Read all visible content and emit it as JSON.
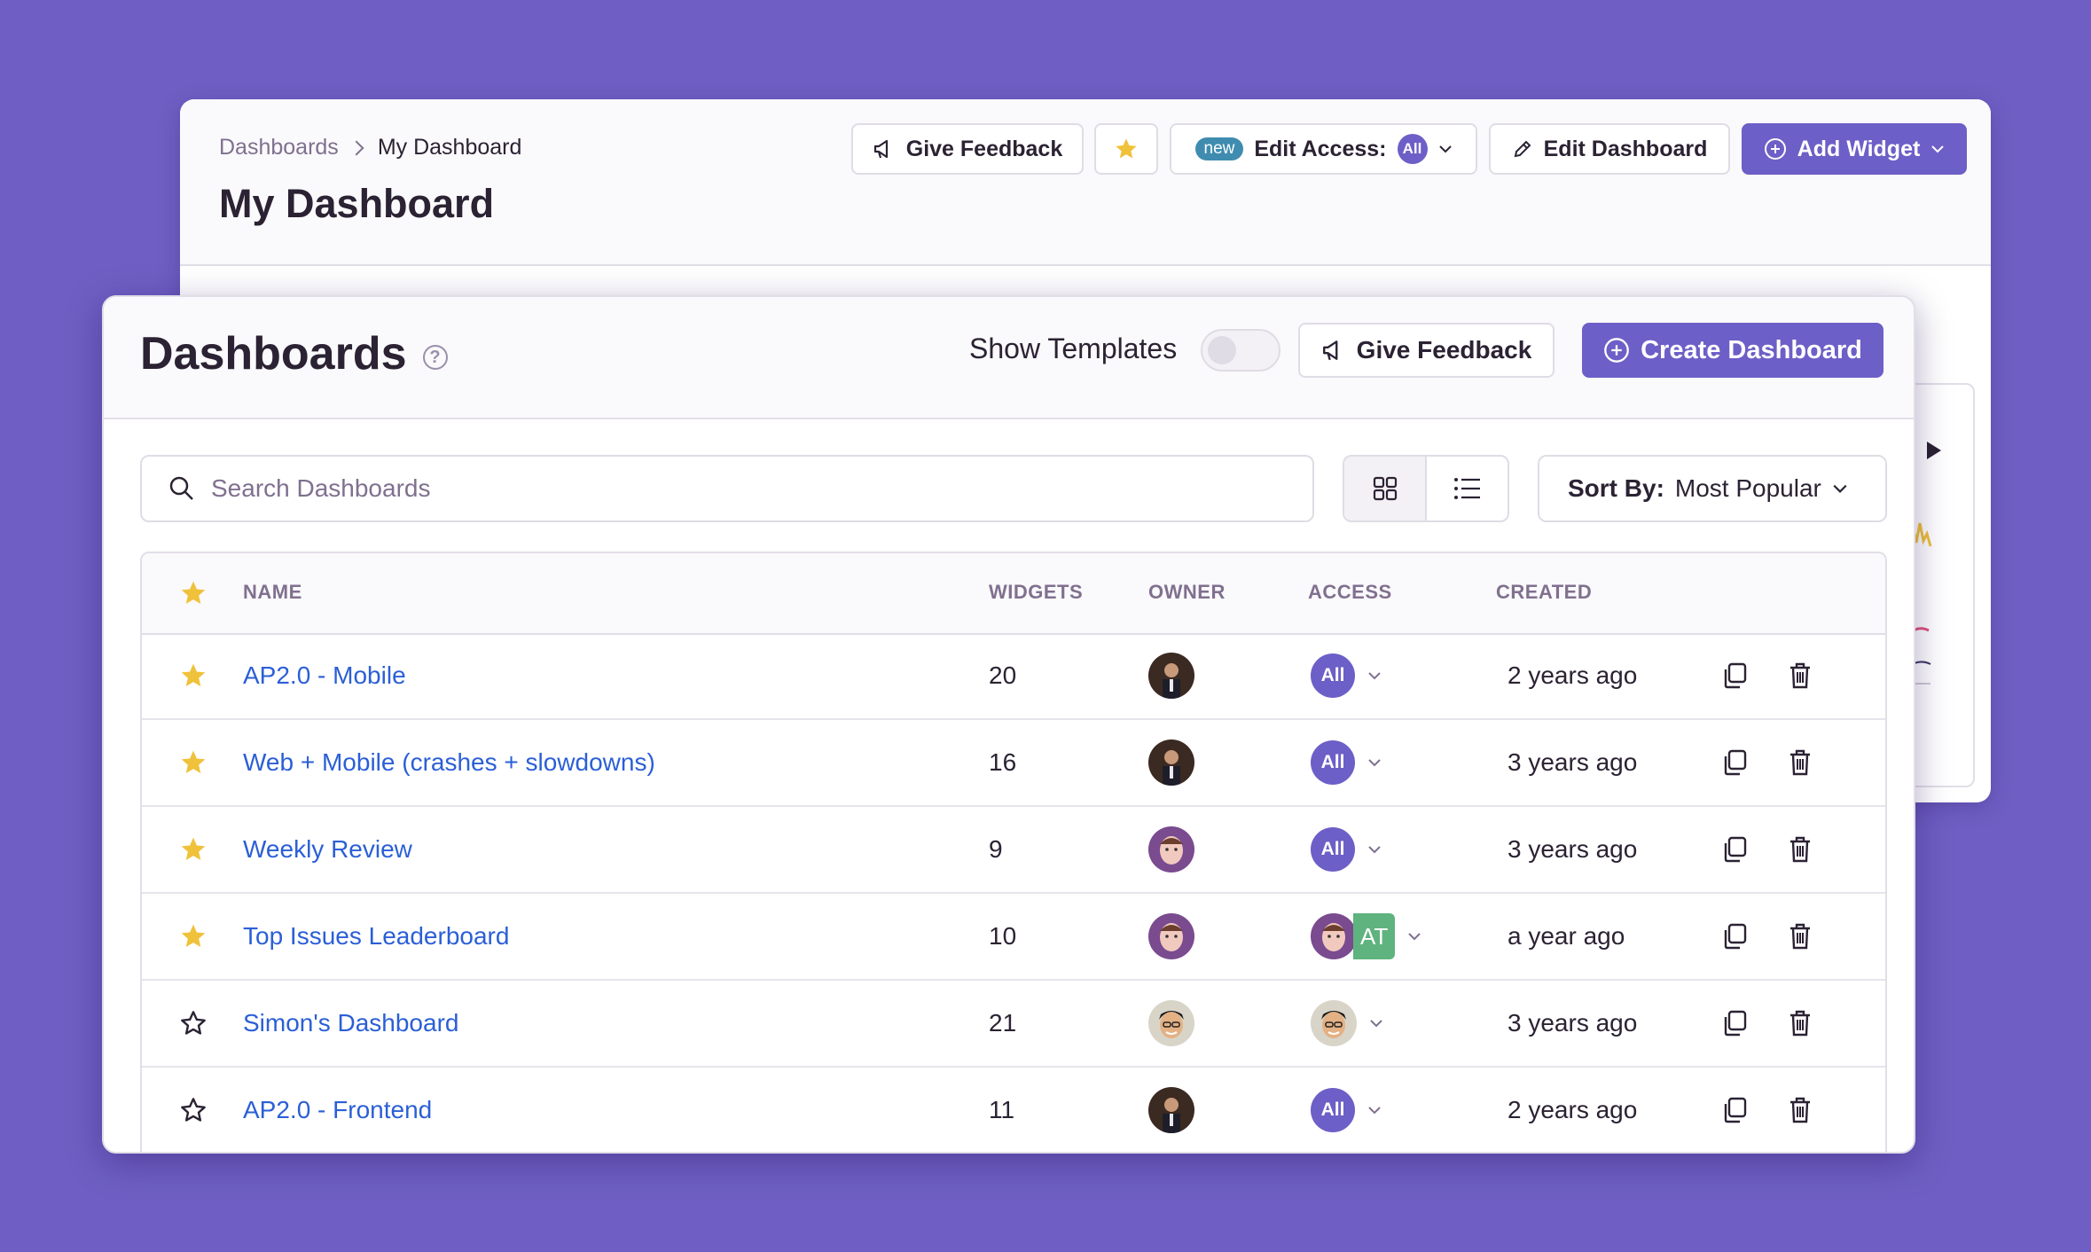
{
  "back": {
    "breadcrumb": [
      "Dashboards",
      "My Dashboard"
    ],
    "title": "My Dashboard",
    "give_feedback": "Give Feedback",
    "new_badge": "new",
    "edit_access": "Edit Access:",
    "edit_access_value": "All",
    "edit_dashboard": "Edit Dashboard",
    "add_widget": "Add Widget"
  },
  "front": {
    "title": "Dashboards",
    "show_templates": "Show Templates",
    "give_feedback": "Give Feedback",
    "create_dashboard": "Create Dashboard",
    "search_placeholder": "Search Dashboards",
    "sort_label": "Sort By:",
    "sort_value": "Most Popular",
    "columns": [
      "NAME",
      "WIDGETS",
      "OWNER",
      "ACCESS",
      "CREATED"
    ],
    "rows": [
      {
        "starred": true,
        "name": "AP2.0 - Mobile",
        "widgets": "20",
        "owner": "avatar-a",
        "access": "All",
        "created": "2 years ago"
      },
      {
        "starred": true,
        "name": "Web + Mobile (crashes + slowdowns)",
        "widgets": "16",
        "owner": "avatar-a",
        "access": "All",
        "created": "3 years ago"
      },
      {
        "starred": true,
        "name": "Weekly Review",
        "widgets": "9",
        "owner": "avatar-b",
        "access": "All",
        "created": "3 years ago"
      },
      {
        "starred": true,
        "name": "Top Issues Leaderboard",
        "widgets": "10",
        "owner": "avatar-b",
        "access": "AT",
        "created": "a year ago"
      },
      {
        "starred": false,
        "name": "Simon's Dashboard",
        "widgets": "21",
        "owner": "avatar-c",
        "access": "",
        "created": "3 years ago"
      },
      {
        "starred": false,
        "name": "AP2.0 - Frontend",
        "widgets": "11",
        "owner": "avatar-a",
        "access": "All",
        "created": "2 years ago"
      }
    ]
  },
  "colors": {
    "background": "#6f5fc4",
    "primary": "#6c5fc7",
    "link": "#2b5fd6",
    "star": "#f0c13a",
    "tag": "#5fb37e"
  }
}
